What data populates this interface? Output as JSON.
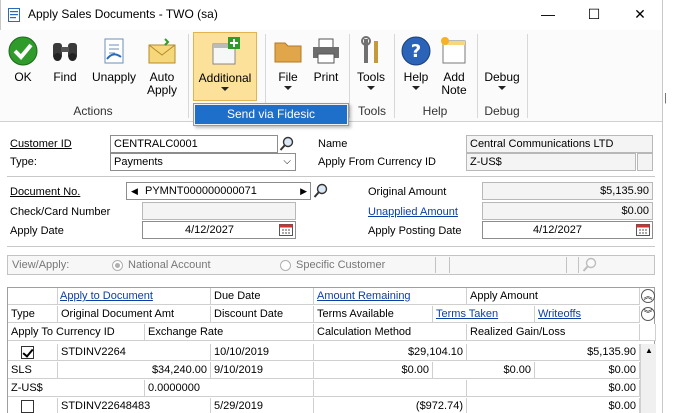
{
  "window": {
    "title": "Apply Sales Documents  -  TWO (sa)",
    "minimize_glyph": "—",
    "maximize_glyph": "☐",
    "close_glyph": "✕"
  },
  "ribbon": {
    "buttons": [
      {
        "label": "OK",
        "icon": "ok-icon"
      },
      {
        "label": "Find",
        "icon": "binoculars-icon"
      },
      {
        "label": "Unapply",
        "icon": "unapply-icon"
      },
      {
        "label": "Auto Apply",
        "icon": "auto-apply-icon"
      },
      {
        "label": "Additional",
        "icon": "additional-icon"
      },
      {
        "label": "File",
        "icon": "folder-icon"
      },
      {
        "label": "Print",
        "icon": "printer-icon"
      },
      {
        "label": "Tools",
        "icon": "tools-icon"
      },
      {
        "label": "Help",
        "icon": "help-icon"
      },
      {
        "label": "Add Note",
        "icon": "note-icon"
      },
      {
        "label": "Debug",
        "icon": "debug-icon"
      }
    ],
    "groups": {
      "actions": "Actions",
      "tools": "Tools",
      "help": "Help",
      "debug": "Debug"
    },
    "auto_apply_line1": "Auto",
    "auto_apply_line2": "Apply",
    "add_note_line1": "Add",
    "add_note_line2": "Note",
    "additional_menu": {
      "item": "Send via Fidesic"
    }
  },
  "form": {
    "customer_id_label": "Customer ID",
    "customer_id": "CENTRALC0001",
    "name_label": "Name",
    "name": "Central Communications LTD",
    "type_label": "Type:",
    "type": "Payments",
    "apply_from_currency_label": "Apply From Currency ID",
    "apply_from_currency": "Z-US$",
    "document_no_label": "Document No.",
    "document_no": "PYMNT000000000071",
    "original_amount_label": "Original Amount",
    "original_amount": "$5,135.90",
    "check_card_label": "Check/Card Number",
    "check_card": "",
    "unapplied_amount_label": "Unapplied Amount",
    "unapplied_amount": "$0.00",
    "apply_date_label": "Apply Date",
    "apply_date": "4/12/2027",
    "apply_posting_date_label": "Apply Posting Date",
    "apply_posting_date": "4/12/2027",
    "view_apply_label": "View/Apply:",
    "national_account": "National Account",
    "specific_customer": "Specific Customer"
  },
  "grid": {
    "headers": {
      "row1": [
        "",
        "Apply to Document",
        "Due Date",
        "Amount Remaining",
        "Apply Amount"
      ],
      "row2": [
        "Type",
        "Original Document Amt",
        "Discount Date",
        "Terms Available",
        "Terms Taken",
        "Writeoffs"
      ],
      "row3": [
        "Apply To Currency ID",
        "Exchange Rate",
        "Calculation Method",
        "Realized Gain/Loss"
      ]
    },
    "rows": [
      {
        "checked": true,
        "document": "STDINV2264",
        "due_date": "10/10/2019",
        "amount_remaining": "$29,104.10",
        "apply_amount": "$5,135.90",
        "type": "SLS",
        "original_amt": "$34,240.00",
        "discount_date": "9/10/2019",
        "terms_available": "$0.00",
        "terms_taken": "$0.00",
        "writeoffs": "$0.00",
        "currency": "Z-US$",
        "exchange_rate": "0.0000000",
        "calc_method": "",
        "gain_loss": "$0.00"
      },
      {
        "checked": false,
        "document": "STDINV22648483",
        "due_date": "5/29/2019",
        "amount_remaining": "($972.74)",
        "apply_amount": "$0.00"
      }
    ]
  }
}
